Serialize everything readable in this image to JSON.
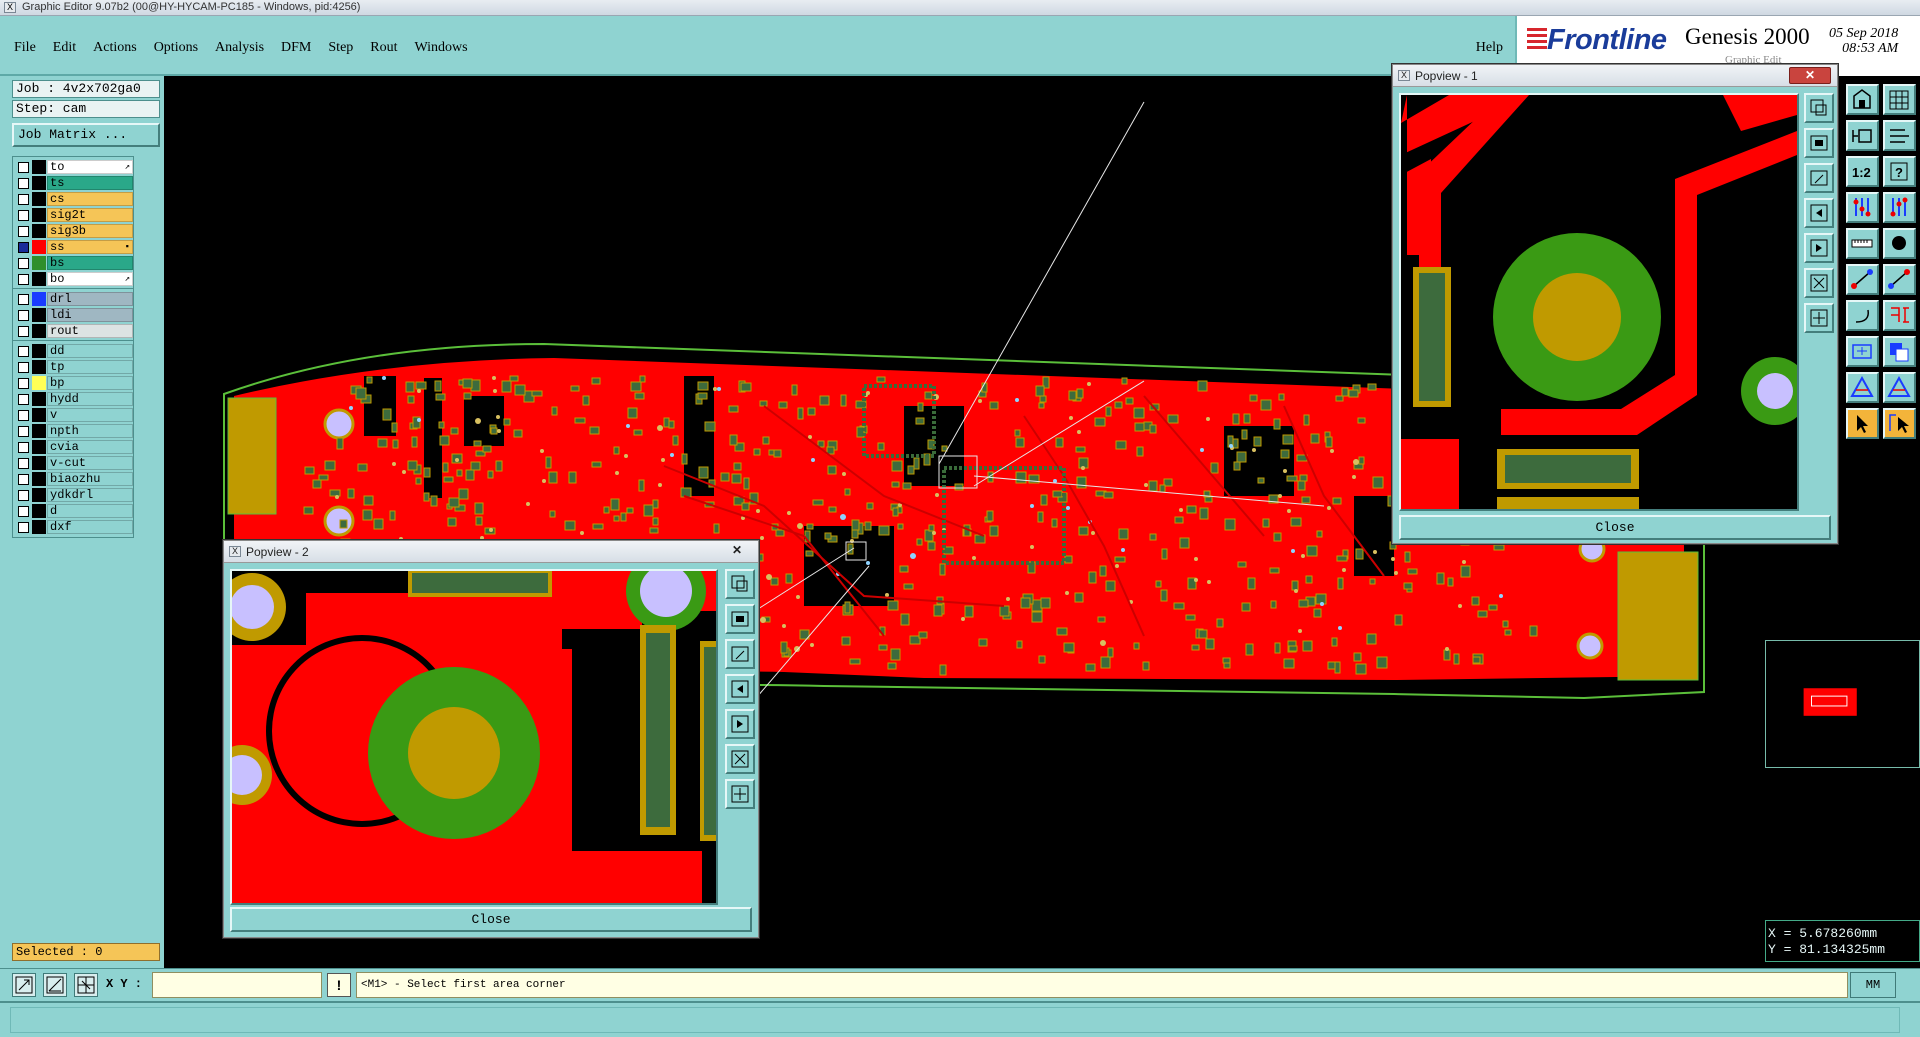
{
  "window": {
    "title": "Graphic Editor 9.07b2 (00@HY-HYCAM-PC185 - Windows, pid:4256)"
  },
  "menu": {
    "items": [
      "File",
      "Edit",
      "Actions",
      "Options",
      "Analysis",
      "DFM",
      "Step",
      "Rout",
      "Windows"
    ],
    "help": "Help"
  },
  "logo": {
    "brand": "Frontline",
    "product": "Genesis 2000",
    "subtitle": "Graphic Edit",
    "date": "05 Sep 2018",
    "time": "08:53 AM"
  },
  "job": {
    "job_label": "Job : 4v2x702ga0",
    "step_label": "Step: cam",
    "matrix_button": "Job Matrix ..."
  },
  "layers": {
    "group1": [
      {
        "name": "to",
        "color": "#ffffff",
        "swatch": "#000000",
        "mark": "↗"
      },
      {
        "name": "ts",
        "color": "#2aa889",
        "swatch": "#000000"
      },
      {
        "name": "cs",
        "color": "#f5c557",
        "swatch": "#000000"
      },
      {
        "name": "sig2t",
        "color": "#f5c557",
        "swatch": "#000000"
      },
      {
        "name": "sig3b",
        "color": "#f5c557",
        "swatch": "#000000"
      },
      {
        "name": "ss",
        "color": "#f5c557",
        "swatch": "#ff0000",
        "mark": "▪",
        "checked": true
      },
      {
        "name": "bs",
        "color": "#2aa889",
        "swatch": "#2f8f2b"
      },
      {
        "name": "bo",
        "color": "#ffffff",
        "swatch": "#000000",
        "mark": "↗"
      }
    ],
    "group2": [
      {
        "name": "drl",
        "color": "#9fb7c2",
        "swatch": "#1a3cff"
      },
      {
        "name": "ldi",
        "color": "#9fb7c2",
        "swatch": "#000000"
      },
      {
        "name": "rout",
        "color": "#dce3e3",
        "swatch": "#000000"
      }
    ],
    "group3": [
      {
        "name": "dd",
        "color": "#8fd3d1",
        "swatch": "#000000"
      },
      {
        "name": "tp",
        "color": "#8fd3d1",
        "swatch": "#000000"
      },
      {
        "name": "bp",
        "color": "#8fd3d1",
        "swatch": "#ffff55"
      },
      {
        "name": "hydd",
        "color": "#8fd3d1",
        "swatch": "#000000"
      },
      {
        "name": "v",
        "color": "#8fd3d1",
        "swatch": "#000000"
      },
      {
        "name": "npth",
        "color": "#8fd3d1",
        "swatch": "#000000"
      },
      {
        "name": "cvia",
        "color": "#8fd3d1",
        "swatch": "#000000"
      },
      {
        "name": "v-cut",
        "color": "#8fd3d1",
        "swatch": "#000000"
      },
      {
        "name": "biaozhu",
        "color": "#8fd3d1",
        "swatch": "#000000"
      },
      {
        "name": "ydkdrl",
        "color": "#8fd3d1",
        "swatch": "#000000"
      },
      {
        "name": "d",
        "color": "#8fd3d1",
        "swatch": "#000000"
      },
      {
        "name": "dxf",
        "color": "#8fd3d1",
        "swatch": "#000000"
      }
    ]
  },
  "selected": "Selected : 0",
  "popup1": {
    "title": "Popview - 1",
    "close_x": "✕",
    "close_button": "Close"
  },
  "popup2": {
    "title": "Popview - 2",
    "close_x": "✕",
    "close_button": "Close"
  },
  "statusbar": {
    "xy_label": "X Y :",
    "xy_value": "",
    "message": "<M1> - Select first area corner",
    "unit": "MM",
    "warn": "!"
  },
  "coords": {
    "x": "X = 5.678260mm",
    "y": "Y = 81.134325mm"
  },
  "colors": {
    "panel": "#8fd3d1",
    "board_copper": "#ff0000",
    "pad_green": "#3a9a14",
    "pad_gold": "#c09a00",
    "pad_dark": "#3d6b3d",
    "hole": "#c8c0ff",
    "outline": "#5bbf3a"
  },
  "icons": [
    "job-icon",
    "fit-icon",
    "zoom-1to1-icon",
    "help-question-icon",
    "measure-icon",
    "dot-icon",
    "route-icon",
    "snap-icon",
    "pan-icon",
    "layer-icon",
    "triangle-icon",
    "cursor-icon"
  ]
}
